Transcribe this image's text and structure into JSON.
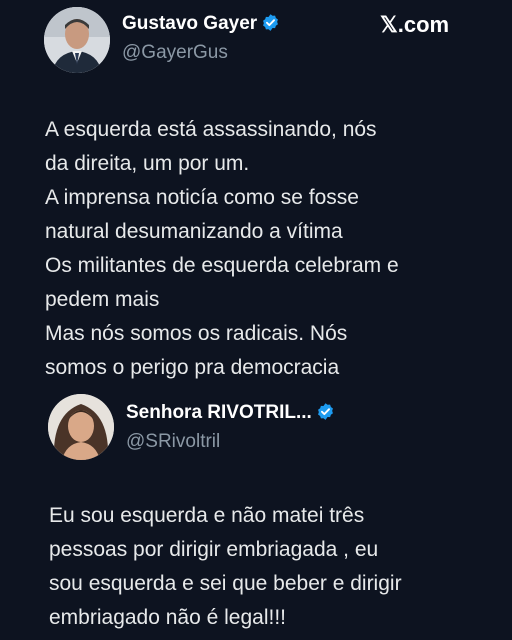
{
  "brand": {
    "label": "𝕏.com"
  },
  "tweet": {
    "author_name": "Gustavo Gayer",
    "author_handle": "@GayerGus",
    "lines": [
      "A esquerda está assassinando, nós",
      "da direita, um por um.",
      "A imprensa noticía como se fosse",
      "natural desumanizando a vítima",
      "Os militantes de esquerda celebram e",
      "pedem mais",
      "Mas nós somos os radicais. Nós",
      "somos o perigo pra democracia"
    ]
  },
  "reply": {
    "author_name": "Senhora RIVOTRIL...",
    "author_handle": "@SRivoltril",
    "lines": [
      "Eu sou esquerda e não matei três",
      "pessoas por dirigir embriagada , eu",
      "sou esquerda e sei que beber e dirigir",
      "embriagado não é legal!!!"
    ]
  },
  "colors": {
    "background": "#0d1320",
    "verified_badge": "#1d9bf0",
    "handle_text": "#8b98a5"
  }
}
